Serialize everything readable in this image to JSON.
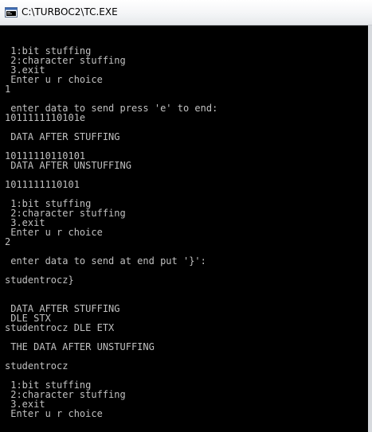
{
  "window": {
    "title": "C:\\TURBOC2\\TC.EXE",
    "icon": "console-window-icon",
    "console_bg": "#000000",
    "console_fg": "#c0c0c0"
  },
  "console": {
    "lines": [
      " 1:bit stuffing",
      " 2:character stuffing",
      " 3.exit",
      " Enter u r choice",
      "1",
      "",
      " enter data to send press 'e' to end:",
      "1011111110101e",
      "",
      " DATA AFTER STUFFING",
      "",
      "10111110110101",
      " DATA AFTER UNSTUFFING",
      "",
      "1011111110101",
      "",
      " 1:bit stuffing",
      " 2:character stuffing",
      " 3.exit",
      " Enter u r choice",
      "2",
      "",
      " enter data to send at end put '}':",
      "",
      "studentrocz}",
      "",
      "",
      " DATA AFTER STUFFING",
      " DLE STX",
      "studentrocz DLE ETX",
      "",
      " THE DATA AFTER UNSTUFFING",
      "",
      "studentrocz",
      "",
      " 1:bit stuffing",
      " 2:character stuffing",
      " 3.exit",
      " Enter u r choice"
    ]
  }
}
